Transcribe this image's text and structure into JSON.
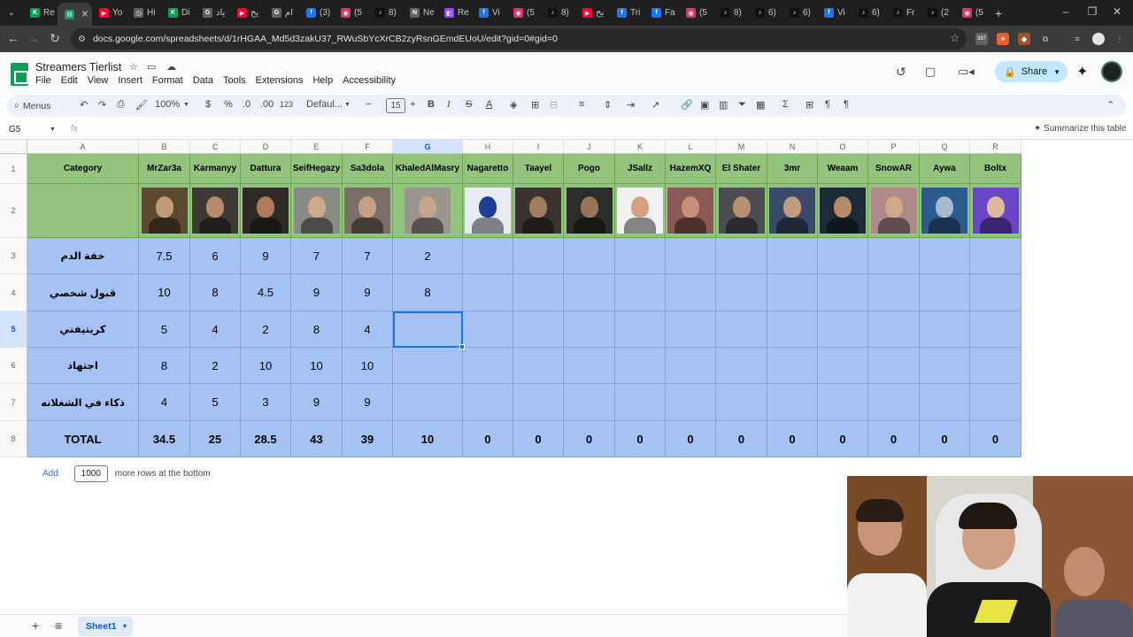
{
  "browser": {
    "tabs": [
      {
        "title": "Re",
        "fav": "K",
        "color": "#0f9d58"
      },
      {
        "title": "",
        "fav": "▤",
        "color": "#0f9d58",
        "active": true
      },
      {
        "title": "Yo",
        "fav": "▶",
        "color": "#ff0033"
      },
      {
        "title": "Hi",
        "fav": "◷",
        "color": "#5f6368"
      },
      {
        "title": "Di",
        "fav": "K",
        "color": "#0f9d58"
      },
      {
        "title": "یاد",
        "fav": "G",
        "color": "#5f6368"
      },
      {
        "title": "یح",
        "fav": "▶",
        "color": "#ff0033"
      },
      {
        "title": "ام",
        "fav": "G",
        "color": "#5f6368"
      },
      {
        "title": "(3)",
        "fav": "f",
        "color": "#1877f2"
      },
      {
        "title": "(5",
        "fav": "◉",
        "color": "#e1306c"
      },
      {
        "title": "8)",
        "fav": "♪",
        "color": "#111111"
      },
      {
        "title": "Ne",
        "fav": "N",
        "color": "#5f6368"
      },
      {
        "title": "Re",
        "fav": "◧",
        "color": "#9146ff"
      },
      {
        "title": "Vi",
        "fav": "f",
        "color": "#1877f2"
      },
      {
        "title": "(5",
        "fav": "◉",
        "color": "#e1306c"
      },
      {
        "title": "8)",
        "fav": "♪",
        "color": "#111111"
      },
      {
        "title": "یح",
        "fav": "▶",
        "color": "#ff0033"
      },
      {
        "title": "Tri",
        "fav": "f",
        "color": "#1877f2"
      },
      {
        "title": "Fa",
        "fav": "f",
        "color": "#1877f2"
      },
      {
        "title": "(5",
        "fav": "◉",
        "color": "#e1306c"
      },
      {
        "title": "8)",
        "fav": "♪",
        "color": "#111111"
      },
      {
        "title": "6)",
        "fav": "♪",
        "color": "#111111"
      },
      {
        "title": "6)",
        "fav": "♪",
        "color": "#111111"
      },
      {
        "title": "Vi",
        "fav": "f",
        "color": "#1877f2"
      },
      {
        "title": "6)",
        "fav": "♪",
        "color": "#111111"
      },
      {
        "title": "Fr",
        "fav": "♪",
        "color": "#111111"
      },
      {
        "title": "(2",
        "fav": "♪",
        "color": "#111111"
      },
      {
        "title": "(5",
        "fav": "◉",
        "color": "#e1306c"
      }
    ],
    "new_tab": "+",
    "url": "docs.google.com/spreadsheets/d/1rHGAA_Md5d3zakU37_RWuSbYcXrCB2zyRsnGEmdEUoU/edit?gid=0#gid=0",
    "ext_badge": "397"
  },
  "sheets": {
    "title": "Streamers Tierlist",
    "menu": [
      "File",
      "Edit",
      "View",
      "Insert",
      "Format",
      "Data",
      "Tools",
      "Extensions",
      "Help",
      "Accessibility"
    ],
    "share_label": "Share",
    "toolbar": {
      "menus_label": "Menus",
      "zoom": "100%",
      "currency": "$",
      "percent": "%",
      "dec_dec": ".0",
      "dec_inc": ".00",
      "number_format": "123",
      "font": "Defaul...",
      "font_size": "15",
      "bold": "B",
      "italic": "I"
    },
    "name_box": "G5",
    "fx": "fx",
    "summarize_label": "Summarize this table"
  },
  "grid": {
    "columns": [
      "A",
      "B",
      "C",
      "D",
      "E",
      "F",
      "G",
      "H",
      "I",
      "J",
      "K",
      "L",
      "M",
      "N",
      "O",
      "P",
      "Q",
      "R"
    ],
    "selected_column": "G",
    "rows": [
      "1",
      "2",
      "3",
      "4",
      "5",
      "6",
      "7",
      "8"
    ],
    "selected_row": "5",
    "header_label": "Category",
    "streamers": [
      "MrZar3a",
      "Karmanyy",
      "Dattura",
      "SeifHegazy",
      "Sa3dola",
      "KhaledAlMasry",
      "Nagaretto",
      "Taayel",
      "Pogo",
      "JSallz",
      "HazemXQ",
      "El Shater",
      "3mr",
      "Weaam",
      "SnowAR",
      "Aywa",
      "Boltx"
    ],
    "photo_colors": [
      "#5b4a2f",
      "#3d3935",
      "#2f2a25",
      "#8a8a85",
      "#7a6f66",
      "#9b9590",
      "#e8ecf2",
      "#3a3330",
      "#2a2d28",
      "#f0f0f0",
      "#8c5a55",
      "#4b4d52",
      "#3a4a6a",
      "#1d2a3a",
      "#b08a8a",
      "#2b5a8f",
      "#6a45c8"
    ],
    "face_colors": [
      "#c29a7a",
      "#b88a6a",
      "#b07a5a",
      "#d0a88a",
      "#c4a08a",
      "#c9a48c",
      "#1c3f94",
      "#a07c60",
      "#9a7458",
      "#d4a080",
      "#c89078",
      "#b89070",
      "#c49a7c",
      "#b88a6a",
      "#d0a88a",
      "#a8b8d0",
      "#e0b8a0"
    ],
    "categories": [
      "خفة الدم",
      "قبول شخصي",
      "كريتيفتي",
      "اجتهاد",
      "ذكاء في الشغلانه"
    ],
    "values": [
      [
        "7.5",
        "6",
        "9",
        "7",
        "7",
        "2",
        "",
        "",
        "",
        "",
        "",
        "",
        "",
        "",
        "",
        "",
        ""
      ],
      [
        "10",
        "8",
        "4.5",
        "9",
        "9",
        "8",
        "",
        "",
        "",
        "",
        "",
        "",
        "",
        "",
        "",
        "",
        ""
      ],
      [
        "5",
        "4",
        "2",
        "8",
        "4",
        "",
        "",
        "",
        "",
        "",
        "",
        "",
        "",
        "",
        "",
        "",
        ""
      ],
      [
        "8",
        "2",
        "10",
        "10",
        "10",
        "",
        "",
        "",
        "",
        "",
        "",
        "",
        "",
        "",
        "",
        "",
        ""
      ],
      [
        "4",
        "5",
        "3",
        "9",
        "9",
        "",
        "",
        "",
        "",
        "",
        "",
        "",
        "",
        "",
        "",
        "",
        ""
      ]
    ],
    "total_label": "TOTAL",
    "totals": [
      "34.5",
      "25",
      "28.5",
      "43",
      "39",
      "10",
      "0",
      "0",
      "0",
      "0",
      "0",
      "0",
      "0",
      "0",
      "0",
      "0",
      "0"
    ],
    "add_label": "Add",
    "add_rows_value": "1000",
    "add_rows_suffix": "more rows at the bottom"
  },
  "sheetbar": {
    "add": "+",
    "list": "≡",
    "tab": "Sheet1"
  },
  "colors": {
    "header_green": "#93c47d",
    "data_blue": "#a4c2f4",
    "selection": "#1a73e8"
  }
}
